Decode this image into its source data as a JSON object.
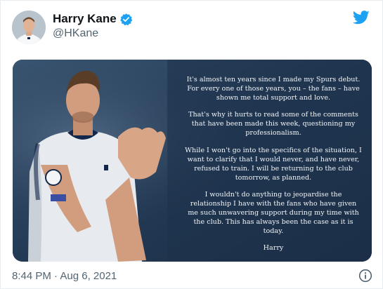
{
  "author": {
    "display_name": "Harry Kane",
    "handle": "@HKane",
    "verified": true
  },
  "icons": {
    "verified": "verified-badge-icon",
    "brand": "twitter-bird-icon",
    "info": "info-icon"
  },
  "colors": {
    "brand": "#1da1f2",
    "muted_text": "#536471",
    "statement_bg": "#24364d"
  },
  "statement": {
    "paragraphs": [
      "It's almost ten years since I made my Spurs debut. For every one of those years, you – the fans – have shown me total support and love.",
      "That's why it hurts to read some of the comments that have been made this week, questioning my professionalism.",
      "While I won't go into the specifics of the situation, I want to clarify that I would never, and have never, refused to train. I will be returning to the club tomorrow, as planned.",
      "I wouldn't do anything to jeopardise the relationship I have with the fans who have given me such unwavering support during my time with the club. This has always been the case as it is today."
    ],
    "signature": "Harry"
  },
  "timestamp": "8:44 PM · Aug 6, 2021"
}
